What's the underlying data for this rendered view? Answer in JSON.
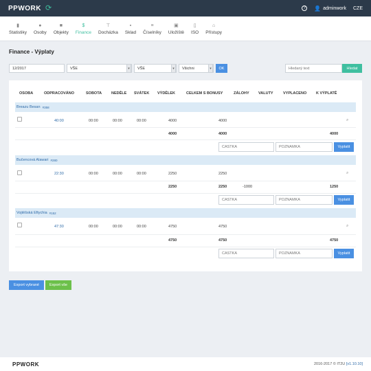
{
  "app": {
    "brand": "PPWORK",
    "footer_brand": "PPWORK",
    "copyright": "2016-2017 © IT2U",
    "version": "[v1.10.10]"
  },
  "topbar": {
    "help_icon": "?",
    "user": "adminwork",
    "lang": "CZE"
  },
  "nav": [
    {
      "label": "Statistiky",
      "icon": "chart-icon"
    },
    {
      "label": "Osoby",
      "icon": "user-icon"
    },
    {
      "label": "Objekty",
      "icon": "briefcase-icon"
    },
    {
      "label": "Finance",
      "icon": "dollar-icon"
    },
    {
      "label": "Docházka",
      "icon": "pin-icon"
    },
    {
      "label": "Sklad",
      "icon": "box-icon"
    },
    {
      "label": "Číselníky",
      "icon": "list-icon"
    },
    {
      "label": "Uložiště",
      "icon": "save-icon"
    },
    {
      "label": "ISO",
      "icon": "document-icon"
    },
    {
      "label": "Přístupy",
      "icon": "lock-icon"
    }
  ],
  "page": {
    "title": "Finance - Výplaty"
  },
  "filters": {
    "period": "12/2017",
    "select1": "VŠE",
    "select2": "VŠE",
    "select3": "Všichni",
    "ok": "OK",
    "search_placeholder": "Hledaný text",
    "search_button": "Hledat"
  },
  "table": {
    "headers": [
      "OSOBA",
      "ODPRACOVÁNO",
      "SOBOTA",
      "NEDĚLE",
      "SVÁTEK",
      "VÝDĚLEK",
      "CELKEM S BONUSY",
      "ZÁLOHY",
      "VALUTY",
      "VYPLACENO",
      "K VÝPLATĚ"
    ],
    "groups": [
      {
        "name": "Breazu Besan",
        "uid": "#358",
        "row": {
          "worked": "40:00",
          "sat": "00:00",
          "sun": "00:00",
          "holiday": "00:00",
          "earn": "4000",
          "total": "4000"
        },
        "sum": {
          "earn": "4000",
          "total": "4000",
          "advances": "",
          "to_pay": "4000"
        }
      },
      {
        "name": "Bučencová Alawari",
        "uid": "#280",
        "row": {
          "worked": "22:30",
          "sat": "00:00",
          "sun": "00:00",
          "holiday": "00:00",
          "earn": "2250",
          "total": "2250"
        },
        "sum": {
          "earn": "2250",
          "total": "2250",
          "advances": "-1000",
          "to_pay": "1250"
        }
      },
      {
        "name": "Vojtěšská Eftychia",
        "uid": "#152",
        "row": {
          "worked": "47:30",
          "sat": "00:00",
          "sun": "00:00",
          "holiday": "00:00",
          "earn": "4750",
          "total": "4750"
        },
        "sum": {
          "earn": "4750",
          "total": "4750",
          "advances": "",
          "to_pay": "4750"
        }
      }
    ],
    "amount_placeholder": "ČÁSTKA",
    "note_placeholder": "POZNÁMKA",
    "pay_button": "Vyplatit"
  },
  "exports": {
    "selected": "Export vybrané",
    "all": "Export vše"
  }
}
